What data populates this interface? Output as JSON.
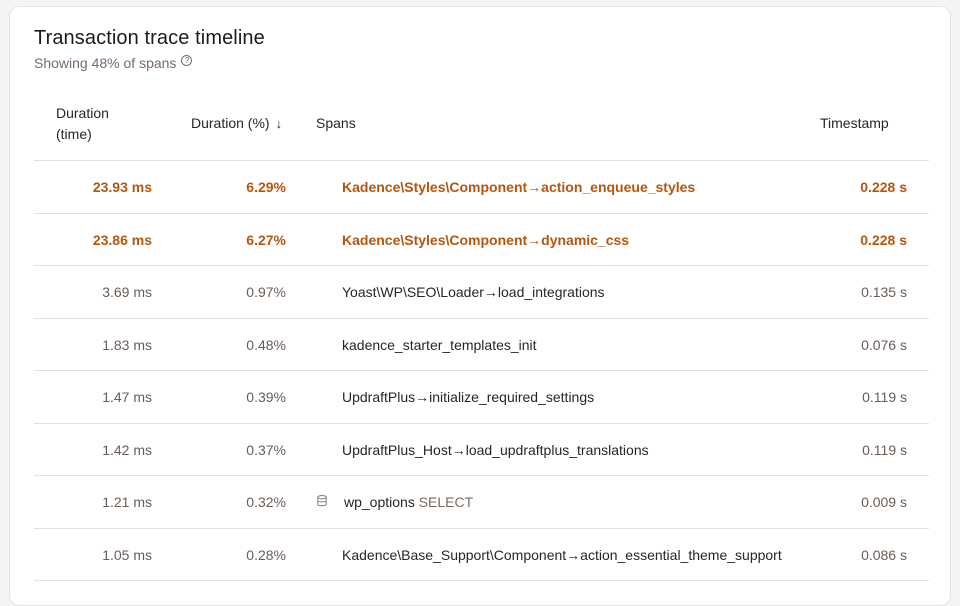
{
  "header": {
    "title": "Transaction trace timeline",
    "subtitle": "Showing 48% of spans",
    "help_icon": "?"
  },
  "columns": {
    "duration_time": "Duration (time)",
    "duration_pct": "Duration (%)",
    "sort_icon": "↓",
    "spans": "Spans",
    "timestamp": "Timestamp"
  },
  "rows": [
    {
      "duration": "23.93 ms",
      "pct": "6.29%",
      "span": "Kadence\\Styles\\Component→action_enqueue_styles",
      "ts": "0.228 s",
      "highlight": true
    },
    {
      "duration": "23.86 ms",
      "pct": "6.27%",
      "span": "Kadence\\Styles\\Component→dynamic_css",
      "ts": "0.228 s",
      "highlight": true
    },
    {
      "duration": "3.69 ms",
      "pct": "0.97%",
      "span": "Yoast\\WP\\SEO\\Loader→load_integrations",
      "ts": "0.135 s"
    },
    {
      "duration": "1.83 ms",
      "pct": "0.48%",
      "span": "kadence_starter_templates_init",
      "ts": "0.076 s"
    },
    {
      "duration": "1.47 ms",
      "pct": "0.39%",
      "span": "UpdraftPlus→initialize_required_settings",
      "ts": "0.119 s"
    },
    {
      "duration": "1.42 ms",
      "pct": "0.37%",
      "span": "UpdraftPlus_Host→load_updraftplus_translations",
      "ts": "0.119 s"
    },
    {
      "duration": "1.21 ms",
      "pct": "0.32%",
      "span": "wp_options",
      "span_op": "SELECT",
      "ts": "0.009 s",
      "icon": "database-icon"
    },
    {
      "duration": "1.05 ms",
      "pct": "0.28%",
      "span": "Kadence\\Base_Support\\Component→action_essential_theme_support",
      "ts": "0.086 s"
    }
  ],
  "colors": {
    "highlight": "#b5560f",
    "muted": "#6b5d56",
    "border": "#e4e0dc"
  }
}
